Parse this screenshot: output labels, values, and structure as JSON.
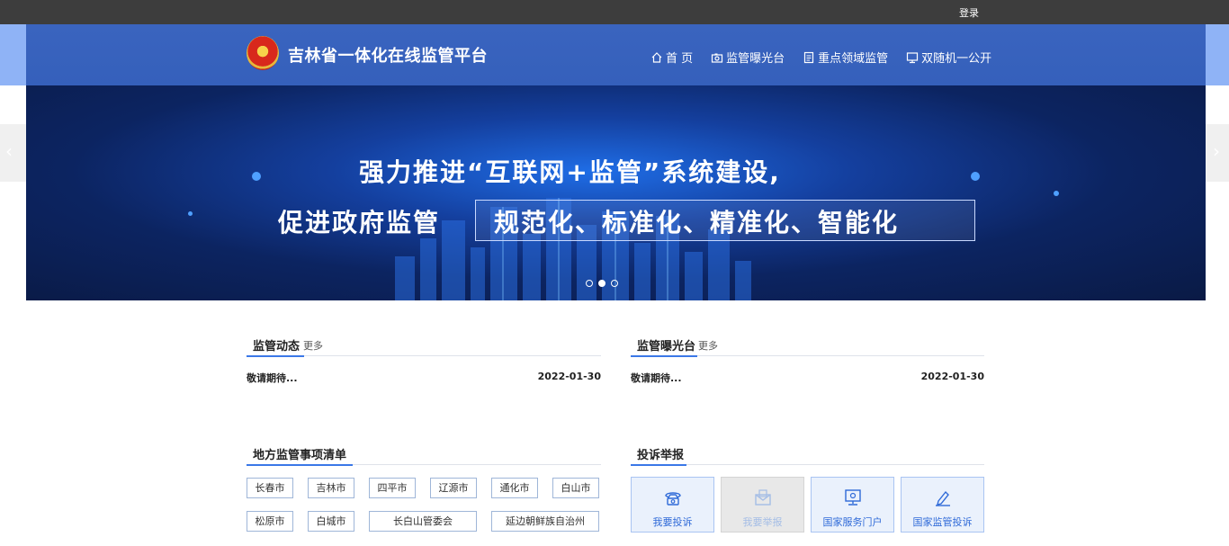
{
  "topbar": {
    "login": "登录"
  },
  "header": {
    "title": "吉林省一体化在线监管平台",
    "nav": [
      {
        "label": "首 页",
        "icon": "home-icon"
      },
      {
        "label": "监管曝光台",
        "icon": "camera-icon"
      },
      {
        "label": "重点领域监管",
        "icon": "document-icon"
      },
      {
        "label": "双随机一公开",
        "icon": "monitor-icon"
      }
    ]
  },
  "banner": {
    "line1": "强力推进“互联网+监管”系统建设,",
    "line2": "促进政府监管",
    "highlight": "规范化、标准化、精准化、智能化",
    "slide_count": 3,
    "active_slide": 2
  },
  "news_left": {
    "title": "监管动态",
    "more": "更多",
    "items": [
      {
        "title": "敬请期待...",
        "date": "2022-01-30"
      }
    ]
  },
  "news_right": {
    "title": "监管曝光台",
    "more": "更多",
    "items": [
      {
        "title": "敬请期待...",
        "date": "2022-01-30"
      }
    ]
  },
  "local_list": {
    "title": "地方监管事项清单",
    "cities": [
      "长春市",
      "吉林市",
      "四平市",
      "辽源市",
      "通化市",
      "白山市",
      "松原市",
      "白城市",
      "长白山管委会",
      "延边朝鲜族自治州"
    ]
  },
  "complaints": {
    "title": "投诉举报",
    "tiles": [
      {
        "label": "我要投诉",
        "icon": "phone-icon"
      },
      {
        "label": "我要举报",
        "icon": "mail-icon"
      },
      {
        "label": "国家服务门户",
        "icon": "monitor-icon"
      },
      {
        "label": "国家监管投诉",
        "icon": "pen-icon"
      }
    ]
  },
  "colors": {
    "header": "#3a64bf",
    "accent": "#3b78e7",
    "topbar": "#3d3d3d"
  }
}
